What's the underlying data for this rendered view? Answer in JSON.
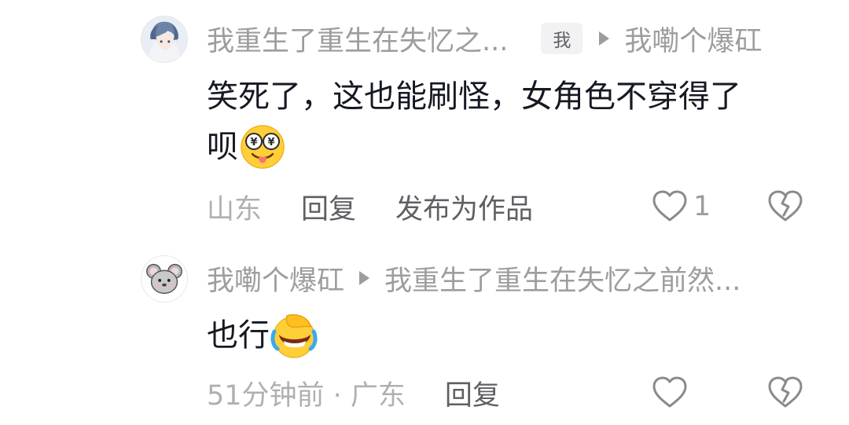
{
  "comments": [
    {
      "author": "我重生了重生在失忆之...",
      "author_badge": "我",
      "reply_to": "我嘞个爆矼",
      "text_line1": "笑死了，这也能刷怪，女角色不穿得了",
      "text_line2": "呗",
      "emoji": "drooling-money-eyes-emoji",
      "location": "山东",
      "reply_label": "回复",
      "publish_label": "发布为作品",
      "like_count": "1",
      "avatar": "anime-character-avatar"
    },
    {
      "author": "我嘞个爆矼",
      "reply_to": "我重生了重生在失忆之前然...",
      "text": "也行",
      "emoji": "facepalm-laughing-crying-emoji",
      "time_location": "51分钟前 · 广东",
      "reply_label": "回复",
      "avatar": "cartoon-mouse-avatar"
    }
  ],
  "colors": {
    "primary_text": "#161823",
    "secondary_text": "#9d9d9f",
    "action_text": "#5f5f64",
    "icon_stroke": "#8a8a8e"
  },
  "icons": {
    "like": "heart-outline-icon",
    "dislike": "broken-heart-icon",
    "reply_arrow": "triangle-right-icon"
  }
}
